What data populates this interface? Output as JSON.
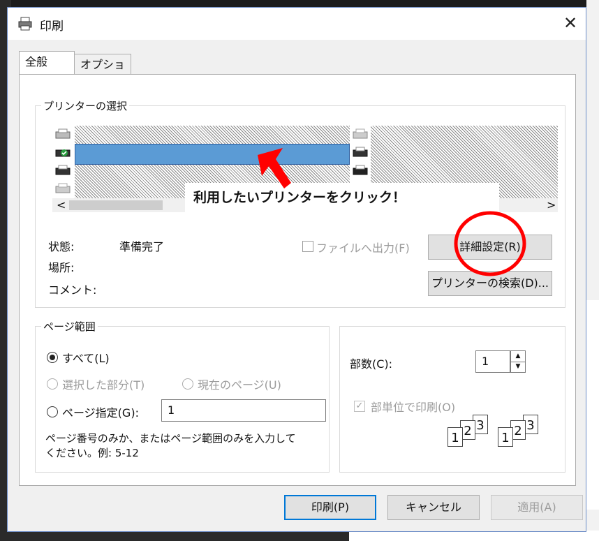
{
  "window": {
    "title": "印刷",
    "close_glyph": "✕"
  },
  "tabs": [
    {
      "label": "全般"
    },
    {
      "label": "オプション"
    }
  ],
  "printer_select": {
    "legend": "プリンターの選択",
    "annotation": "利用したいプリンターをクリック！",
    "scroll_left": "<",
    "scroll_right": ">"
  },
  "status": {
    "state_label": "状態:",
    "state_value": "準備完了",
    "location_label": "場所:",
    "comment_label": "コメント:"
  },
  "file_output": {
    "label": "ファイルへ出力(F)",
    "checked": false
  },
  "buttons": {
    "advanced": "詳細設定(R)",
    "find_printer": "プリンターの検索(D)...",
    "print": "印刷(P)",
    "cancel": "キャンセル",
    "apply": "適用(A)"
  },
  "page_range": {
    "legend": "ページ範囲",
    "all": "すべて(L)",
    "selection": "選択した部分(T)",
    "current": "現在のページ(U)",
    "pages": "ページ指定(G):",
    "pages_value": "1",
    "help": "ページ番号のみか、またはページ範囲のみを入力して",
    "help2": "ください。例: 5-12"
  },
  "copies": {
    "label": "部数(C):",
    "value": "1",
    "collate": "部単位で印刷(O)",
    "collate_checked": true,
    "collate_pages": [
      "1",
      "2",
      "3"
    ]
  },
  "colors": {
    "accent": "#0078d7",
    "selection": "#5b9bd5",
    "arrow": "#ff0000",
    "circle": "#ff0000"
  }
}
